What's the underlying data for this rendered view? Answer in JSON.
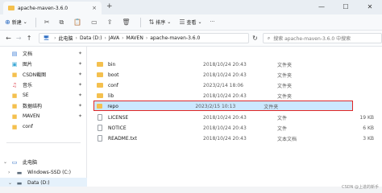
{
  "window": {
    "tab_title": "apache-maven-3.6.0",
    "tab_close": "×",
    "new_tab": "+",
    "minimize": "—",
    "maximize": "☐",
    "close": "✕"
  },
  "toolbar": {
    "new_label": "新建",
    "new_dropdown": "⌄",
    "sort_label": "排序",
    "sort_dropdown": "⌄",
    "view_label": "查看",
    "view_dropdown": "⌄",
    "more": "···"
  },
  "address": {
    "back": "←",
    "forward": "→",
    "up": "↑",
    "crumbs": [
      "此电脑",
      "Data (D:)",
      "JAVA",
      "MAVEN",
      "apache-maven-3.6.0"
    ],
    "refresh": "↻",
    "search_placeholder": "搜索 apache-maven-3.6.0 中搜索"
  },
  "sidebar": {
    "quick": [
      {
        "label": "文档",
        "icon": "document-icon"
      },
      {
        "label": "图片",
        "icon": "picture-icon"
      },
      {
        "label": "CSDN截图",
        "icon": "folder-icon"
      },
      {
        "label": "音乐",
        "icon": "music-icon"
      },
      {
        "label": "SE",
        "icon": "folder-icon"
      },
      {
        "label": "数据结构",
        "icon": "folder-icon"
      },
      {
        "label": "MAVEN",
        "icon": "folder-icon"
      },
      {
        "label": "conf",
        "icon": "folder-icon"
      }
    ],
    "pc_label": "此电脑",
    "drives": [
      {
        "label": "Windows-SSD (C:)"
      },
      {
        "label": "Data (D:)"
      }
    ]
  },
  "files": [
    {
      "name": "bin",
      "date": "2018/10/24 20:43",
      "type": "文件夹",
      "size": "",
      "kind": "folder"
    },
    {
      "name": "boot",
      "date": "2018/10/24 20:43",
      "type": "文件夹",
      "size": "",
      "kind": "folder"
    },
    {
      "name": "conf",
      "date": "2023/2/14 18:06",
      "type": "文件夹",
      "size": "",
      "kind": "folder"
    },
    {
      "name": "lib",
      "date": "2018/10/24 20:43",
      "type": "文件夹",
      "size": "",
      "kind": "folder"
    },
    {
      "name": "repo",
      "date": "2023/2/15 10:13",
      "type": "文件夹",
      "size": "",
      "kind": "folder"
    },
    {
      "name": "LICENSE",
      "date": "2018/10/24 20:43",
      "type": "文件",
      "size": "19 KB",
      "kind": "file"
    },
    {
      "name": "NOTICE",
      "date": "2018/10/24 20:43",
      "type": "文件",
      "size": "6 KB",
      "kind": "file"
    },
    {
      "name": "README.txt",
      "date": "2018/10/24 20:43",
      "type": "文本文档",
      "size": "3 KB",
      "kind": "file"
    }
  ],
  "status": {
    "watermark": "CSDN @上进的新手"
  },
  "colors": {
    "selection": "#cce8ff",
    "highlight_border": "#e02626",
    "folder": "#f4c04e",
    "accent": "#2a6bc2"
  }
}
